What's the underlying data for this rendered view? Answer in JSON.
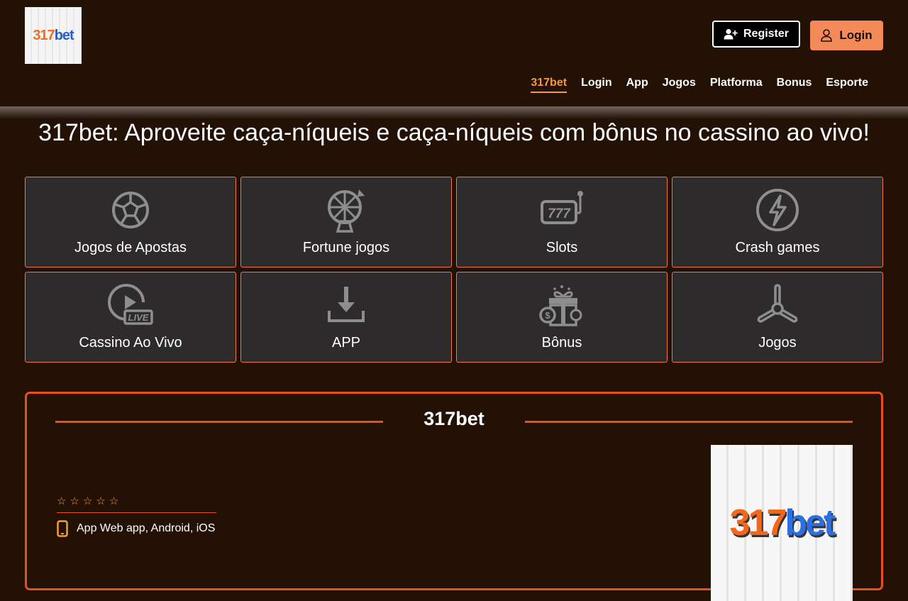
{
  "brand": {
    "logo_number": "317",
    "logo_suffix": "bet"
  },
  "header": {
    "register_label": "Register",
    "login_label": "Login"
  },
  "nav": {
    "items": [
      {
        "label": "317bet",
        "active": true
      },
      {
        "label": "Login"
      },
      {
        "label": "App"
      },
      {
        "label": "Jogos"
      },
      {
        "label": "Platforma"
      },
      {
        "label": "Bonus"
      },
      {
        "label": "Esporte"
      }
    ]
  },
  "page": {
    "title": "317bet: Aproveite caça-níqueis e caça-níqueis com bônus no cassino ao vivo!"
  },
  "categories": [
    {
      "label": "Jogos de Apostas",
      "icon": "soccer-ball-icon"
    },
    {
      "label": "Fortune jogos",
      "icon": "fortune-wheel-icon"
    },
    {
      "label": "Slots",
      "icon": "slot-machine-icon"
    },
    {
      "label": "Crash games",
      "icon": "lightning-icon"
    },
    {
      "label": "Cassino Ao Vivo",
      "icon": "live-play-icon"
    },
    {
      "label": "APP",
      "icon": "download-icon"
    },
    {
      "label": "Bônus",
      "icon": "gift-bonus-icon"
    },
    {
      "label": "Jogos",
      "icon": "propeller-icon"
    }
  ],
  "panel": {
    "title": "317bet",
    "rating_stars": 5,
    "star_glyph": "☆",
    "platforms": "App Web app, Android, iOS",
    "image_number": "317",
    "image_suffix": "bet"
  },
  "colors": {
    "background": "#231106",
    "accent_orange": "#f58a59",
    "nav_active": "#f39a3a",
    "border_orange": "#e8501a",
    "tile_bg": "#2d2b2b"
  }
}
